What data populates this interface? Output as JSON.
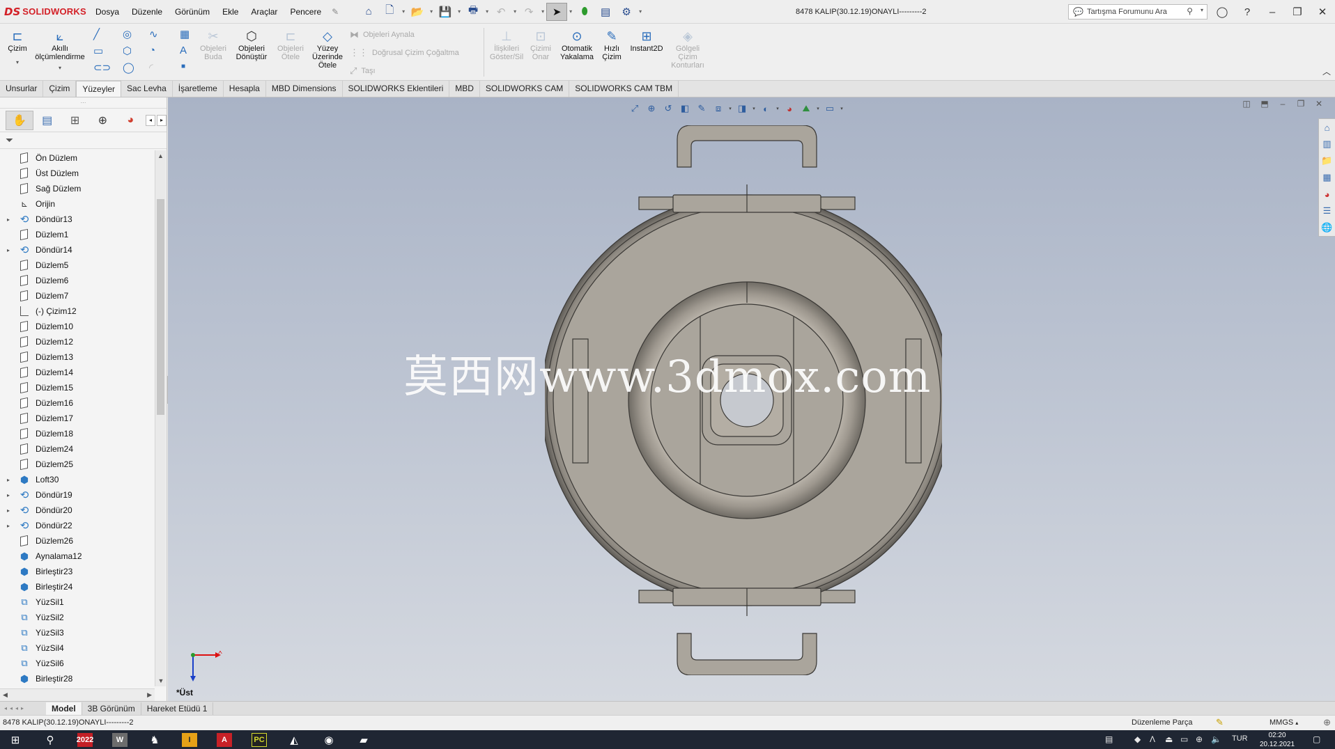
{
  "app": {
    "brand": "SOLIDWORKS",
    "brand_prefix": "DS",
    "document_title": "8478 KALIP(30.12.19)ONAYLI---------2"
  },
  "menu": [
    "Dosya",
    "Düzenle",
    "Görünüm",
    "Ekle",
    "Araçlar",
    "Pencere"
  ],
  "search": {
    "placeholder": "Tartışma Forumunu Ara"
  },
  "ribbon": {
    "sketch": "Çizim",
    "smart_dim_line1": "Akıllı",
    "smart_dim_line2": "ölçümlendirme",
    "trim_line1": "Objeleri",
    "trim_line2": "Buda",
    "convert_line1": "Objeleri",
    "convert_line2": "Dönüştür",
    "offset_line1": "Objeleri",
    "offset_line2": "Ötele",
    "surface_offset_line1": "Yüzey",
    "surface_offset_line2": "Üzerinde",
    "surface_offset_line3": "Ötele",
    "mirror": "Objeleri Aynala",
    "linear_pattern": "Doğrusal Çizim Çoğaltma",
    "move": "Taşı",
    "relations_line1": "İlişkileri",
    "relations_line2": "Göster/Sil",
    "repair_line1": "Çizimi",
    "repair_line2": "Onar",
    "snap_line1": "Otomatik",
    "snap_line2": "Yakalama",
    "rapid_line1": "Hızlı",
    "rapid_line2": "Çizim",
    "instant2d": "Instant2D",
    "shaded_line1": "Gölgeli",
    "shaded_line2": "Çizim",
    "shaded_line3": "Konturları"
  },
  "command_tabs": [
    "Unsurlar",
    "Çizim",
    "Yüzeyler",
    "Sac Levha",
    "İşaretleme",
    "Hesapla",
    "MBD Dimensions",
    "SOLIDWORKS Eklentileri",
    "MBD",
    "SOLIDWORKS CAM",
    "SOLIDWORKS CAM TBM"
  ],
  "active_command_tab": "Yüzeyler",
  "feature_tree": [
    {
      "label": "Ön Düzlem",
      "type": "plane",
      "expandable": false
    },
    {
      "label": "Üst Düzlem",
      "type": "plane",
      "expandable": false
    },
    {
      "label": "Sağ Düzlem",
      "type": "plane",
      "expandable": false
    },
    {
      "label": "Orijin",
      "type": "origin",
      "expandable": false
    },
    {
      "label": "Döndür13",
      "type": "revolve",
      "expandable": true
    },
    {
      "label": "Düzlem1",
      "type": "plane",
      "expandable": false
    },
    {
      "label": "Döndür14",
      "type": "revolve",
      "expandable": true
    },
    {
      "label": "Düzlem5",
      "type": "plane",
      "expandable": false
    },
    {
      "label": "Düzlem6",
      "type": "plane",
      "expandable": false
    },
    {
      "label": "Düzlem7",
      "type": "plane",
      "expandable": false
    },
    {
      "label": "(-) Çizim12",
      "type": "sketch",
      "expandable": false
    },
    {
      "label": "Düzlem10",
      "type": "plane",
      "expandable": false
    },
    {
      "label": "Düzlem12",
      "type": "plane",
      "expandable": false
    },
    {
      "label": "Düzlem13",
      "type": "plane",
      "expandable": false
    },
    {
      "label": "Düzlem14",
      "type": "plane",
      "expandable": false
    },
    {
      "label": "Düzlem15",
      "type": "plane",
      "expandable": false
    },
    {
      "label": "Düzlem16",
      "type": "plane",
      "expandable": false
    },
    {
      "label": "Düzlem17",
      "type": "plane",
      "expandable": false
    },
    {
      "label": "Düzlem18",
      "type": "plane",
      "expandable": false
    },
    {
      "label": "Düzlem24",
      "type": "plane",
      "expandable": false
    },
    {
      "label": "Düzlem25",
      "type": "plane",
      "expandable": false
    },
    {
      "label": "Loft30",
      "type": "feature",
      "expandable": true
    },
    {
      "label": "Döndür19",
      "type": "revolve",
      "expandable": true
    },
    {
      "label": "Döndür20",
      "type": "revolve",
      "expandable": true
    },
    {
      "label": "Döndür22",
      "type": "revolve",
      "expandable": true
    },
    {
      "label": "Düzlem26",
      "type": "plane",
      "expandable": false
    },
    {
      "label": "Aynalama12",
      "type": "feature",
      "expandable": false
    },
    {
      "label": "Birleştir23",
      "type": "feature",
      "expandable": false
    },
    {
      "label": "Birleştir24",
      "type": "feature",
      "expandable": false
    },
    {
      "label": "YüzSil1",
      "type": "surf",
      "expandable": false
    },
    {
      "label": "YüzSil2",
      "type": "surf",
      "expandable": false
    },
    {
      "label": "YüzSil3",
      "type": "surf",
      "expandable": false
    },
    {
      "label": "YüzSil4",
      "type": "surf",
      "expandable": false
    },
    {
      "label": "YüzSil6",
      "type": "surf",
      "expandable": false
    },
    {
      "label": "Birleştir28",
      "type": "feature",
      "expandable": false
    }
  ],
  "viewport": {
    "watermark": "莫西网www.3dmox.com",
    "view_name": "*Üst",
    "triad_x_label": "X"
  },
  "model_tabs": [
    "Model",
    "3B Görünüm",
    "Hareket Etüdü 1"
  ],
  "active_model_tab": "Model",
  "status": {
    "left": "8478 KALIP(30.12.19)ONAYLI---------2",
    "mode": "Düzenleme Parça",
    "units": "MMGS"
  },
  "taskbar": {
    "time": "02:20",
    "date": "20.12.2021",
    "lang": "TUR",
    "sw_version": "2022"
  },
  "colors": {
    "brand": "#d32027",
    "accent": "#2a6dbb",
    "model_fill": "#aaa59c"
  }
}
